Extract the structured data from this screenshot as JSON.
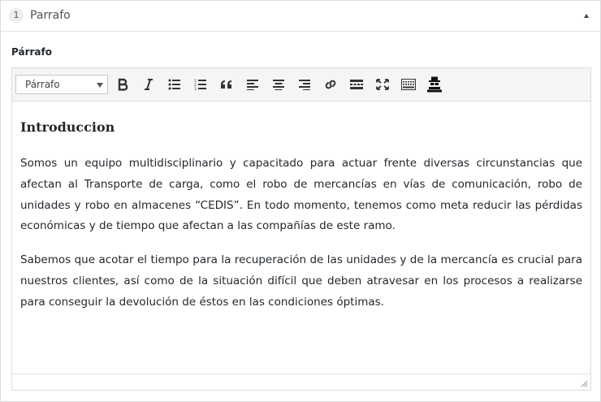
{
  "panel": {
    "badge": "1",
    "title": "Parrafo"
  },
  "field": {
    "label": "Párrafo"
  },
  "toolbar": {
    "format_select": "Párrafo",
    "buttons": [
      {
        "name": "bold-button",
        "icon": "bold-icon"
      },
      {
        "name": "italic-button",
        "icon": "italic-icon"
      },
      {
        "name": "bullet-list-button",
        "icon": "bullet-list-icon"
      },
      {
        "name": "numbered-list-button",
        "icon": "numbered-list-icon"
      },
      {
        "name": "blockquote-button",
        "icon": "quote-icon"
      },
      {
        "name": "align-left-button",
        "icon": "align-left-icon"
      },
      {
        "name": "align-center-button",
        "icon": "align-center-icon"
      },
      {
        "name": "align-right-button",
        "icon": "align-right-icon"
      },
      {
        "name": "link-button",
        "icon": "link-icon"
      },
      {
        "name": "read-more-button",
        "icon": "read-more-icon"
      },
      {
        "name": "fullscreen-button",
        "icon": "fullscreen-icon"
      },
      {
        "name": "toolbar-toggle-button",
        "icon": "keyboard-icon"
      },
      {
        "name": "incognito-button",
        "icon": "incognito-icon"
      }
    ]
  },
  "content": {
    "heading": "Introduccion",
    "paragraphs": [
      "Somos un equipo multidisciplinario y capacitado para actuar frente diversas circunstancias que afectan al Transporte de carga, como el robo de mercancías en vías de comunicación, robo de unidades y robo en almacenes “CEDIS”. En todo momento, tenemos como meta reducir las pérdidas económicas y de tiempo que afectan a las compañías de este ramo.",
      "Sabemos que acotar el tiempo para la recuperación de las unidades y de la mercancía es crucial para nuestros clientes, así como de la situación difícil que deben atravesar en los procesos a realizarse para conseguir la devolución de éstos en las condiciones óptimas."
    ]
  }
}
